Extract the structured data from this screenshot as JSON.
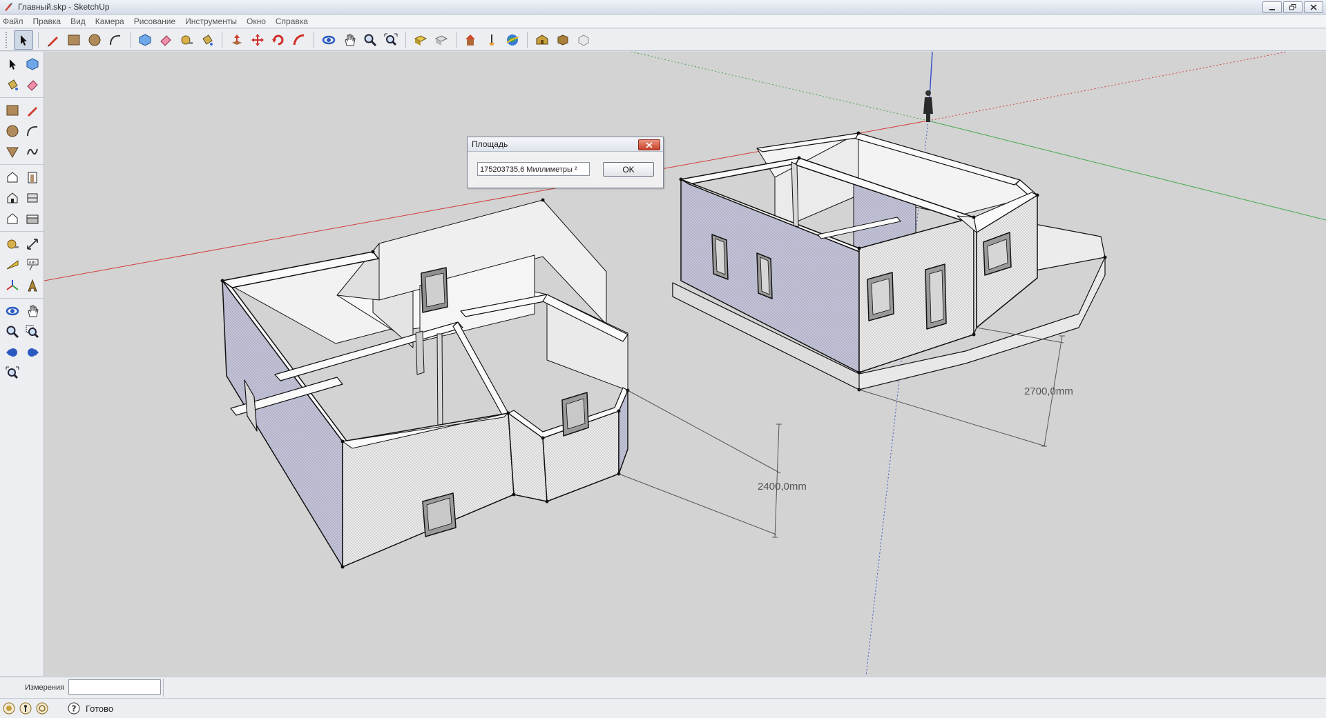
{
  "window": {
    "title": "Главный.skp - SketchUp",
    "controls": [
      "minimize",
      "restore",
      "close"
    ]
  },
  "menu": {
    "items": [
      {
        "label": "Файл",
        "hotkey": "Ф"
      },
      {
        "label": "Правка",
        "hotkey": "П"
      },
      {
        "label": "Вид",
        "hotkey": "В"
      },
      {
        "label": "Камера",
        "hotkey": "К"
      },
      {
        "label": "Рисование",
        "hotkey": "Р"
      },
      {
        "label": "Инструменты",
        "hotkey": "И"
      },
      {
        "label": "Окно",
        "hotkey": "О"
      },
      {
        "label": "Справка",
        "hotkey": "С"
      }
    ]
  },
  "toolbar_top": {
    "groups": [
      [
        "select-tool"
      ],
      [
        "pencil-tool",
        "rectangle-tool",
        "circle-tool",
        "arc-tool"
      ],
      [
        "make-component-tool",
        "eraser-tool",
        "tape-measure-tool",
        "paint-bucket-tool"
      ],
      [
        "push-pull-tool",
        "move-tool",
        "rotate-tool",
        "follow-me-tool"
      ],
      [
        "orbit-tool",
        "pan-tool",
        "zoom-tool",
        "zoom-extents-tool"
      ],
      [
        "get-models-tool",
        "share-model-tool"
      ],
      [
        "get-photo-texture-tool",
        "place-model-tool",
        "google-earth-tool"
      ],
      [
        "warehouse-tool",
        "extension-warehouse-tool",
        "component-tool"
      ]
    ]
  },
  "toolbar_left": {
    "groups": [
      [
        "select-tool",
        "make-component-tool",
        "paint-bucket-tool",
        "eraser-tool"
      ],
      [
        "rectangle-tool",
        "line-tool",
        "circle-tool",
        "arc-tool",
        "polygon-tool",
        "freehand-tool"
      ],
      [
        "push-pull-tool",
        "follow-me-tool",
        "offset-tool",
        "move-tool",
        "rotate-tool",
        "scale-tool"
      ],
      [
        "tape-measure-tool",
        "dimension-tool",
        "protractor-tool",
        "text-tool",
        "axes-tool",
        "3d-text-tool"
      ],
      [
        "orbit-tool",
        "pan-tool",
        "zoom-tool",
        "zoom-window-tool",
        "previous-view-tool",
        "next-view-tool",
        "zoom-extents-tool"
      ]
    ]
  },
  "scene": {
    "dimension_left": "2400,0mm",
    "dimension_right": "2700,0mm"
  },
  "dialog": {
    "title": "Площадь",
    "value": "175203735,6 Миллиметры ²",
    "ok_label": "OK"
  },
  "measurements": {
    "label": "Измерения",
    "value": ""
  },
  "status": {
    "text": "Готово"
  },
  "colors": {
    "viewport_bg": "#d3d3d3",
    "axis_red": "#d23a3a",
    "axis_green": "#3fa64a",
    "axis_blue": "#3a52c8",
    "wall_face": "#f2f2f2",
    "wall_back_face": "#c9c9dd"
  }
}
